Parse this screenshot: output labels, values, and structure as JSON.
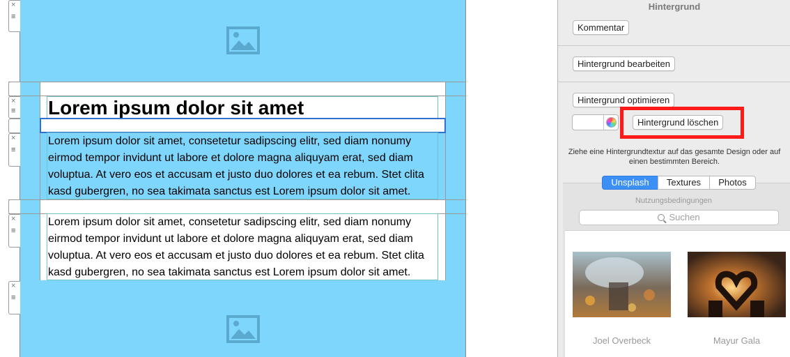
{
  "editor": {
    "heading": "Lorem ipsum dolor sit amet",
    "paragraph_1": "Lorem ipsum dolor sit amet, consetetur sadipscing elitr, sed diam nonumy eirmod tempor invidunt ut labore et dolore magna aliquyam erat, sed diam voluptua. At vero eos et accusam et justo duo dolores et ea rebum. Stet clita kasd gubergren, no sea takimata sanctus est Lorem ipsum dolor sit amet.",
    "paragraph_2": "Lorem ipsum dolor sit amet, consetetur sadipscing elitr, sed diam nonumy eirmod tempor invidunt ut labore et dolore magna aliquyam erat, sed diam voluptua. At vero eos et accusam et justo duo dolores et ea rebum. Stet clita kasd gubergren, no sea takimata sanctus est Lorem ipsum dolor sit amet.",
    "handle_close_glyph": "×",
    "handle_menu_glyph": "≡",
    "block_color": "#7fd6fc",
    "image_placeholder_icon": "image-placeholder-icon"
  },
  "inspector": {
    "title": "Hintergrund",
    "comment_button": "Kommentar",
    "edit_background_button": "Hintergrund bearbeiten",
    "optimize_background_button": "Hintergrund optimieren",
    "delete_background_button": "Hintergrund löschen",
    "hint_text": "Ziehe eine Hintergrundtextur auf das gesamte Design oder auf einen bestimmten Bereich.",
    "tabs": [
      {
        "label": "Unsplash",
        "active": true
      },
      {
        "label": "Textures",
        "active": false
      },
      {
        "label": "Photos",
        "active": false
      }
    ],
    "terms_link": "Nutzungsbedingungen",
    "search_placeholder": "Suchen",
    "photos": [
      {
        "credit": "Joel Overbeck"
      },
      {
        "credit": "Mayur Gala"
      }
    ],
    "highlight_color": "#ff1a1a",
    "accent_color": "#3b8ff5"
  }
}
